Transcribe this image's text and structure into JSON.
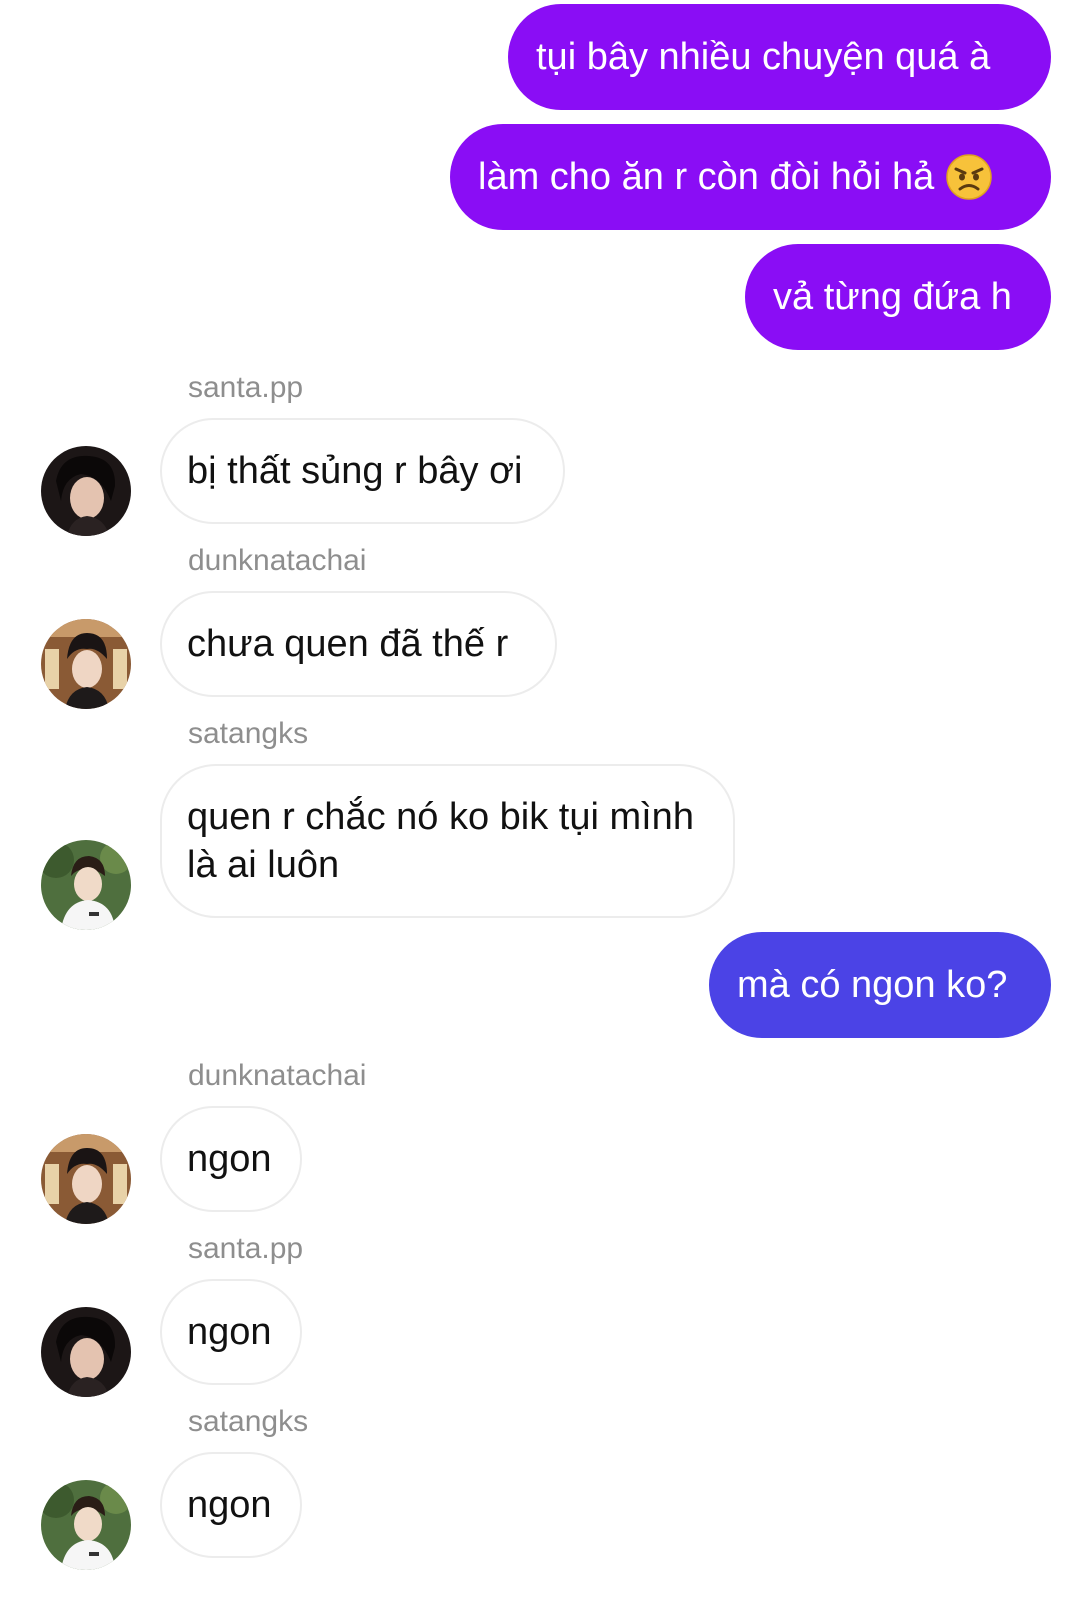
{
  "colors": {
    "outgoing_purple": "#8a0df5",
    "outgoing_blue": "#4b43e6",
    "incoming_border": "#ececec",
    "sender_name": "#8e8e8e"
  },
  "messages": [
    {
      "direction": "out",
      "text": "tụi bây nhiều chuyện quá à"
    },
    {
      "direction": "out",
      "text": "làm cho ăn r còn đòi hỏi hả",
      "emoji": "angry-face-icon"
    },
    {
      "direction": "out",
      "text": "vả từng đứa h"
    },
    {
      "direction": "in",
      "sender": "santa.pp",
      "text": "bị thất sủng r bây ơi"
    },
    {
      "direction": "in",
      "sender": "dunknatachai",
      "text": "chưa quen đã thế r"
    },
    {
      "direction": "in",
      "sender": "satangks",
      "text": "quen r chắc nó ko bik tụi mình là ai luôn"
    },
    {
      "direction": "out",
      "text": "mà có ngon ko?"
    },
    {
      "direction": "in",
      "sender": "dunknatachai",
      "text": "ngon"
    },
    {
      "direction": "in",
      "sender": "santa.pp",
      "text": "ngon"
    },
    {
      "direction": "in",
      "sender": "satangks",
      "text": "ngon"
    }
  ]
}
